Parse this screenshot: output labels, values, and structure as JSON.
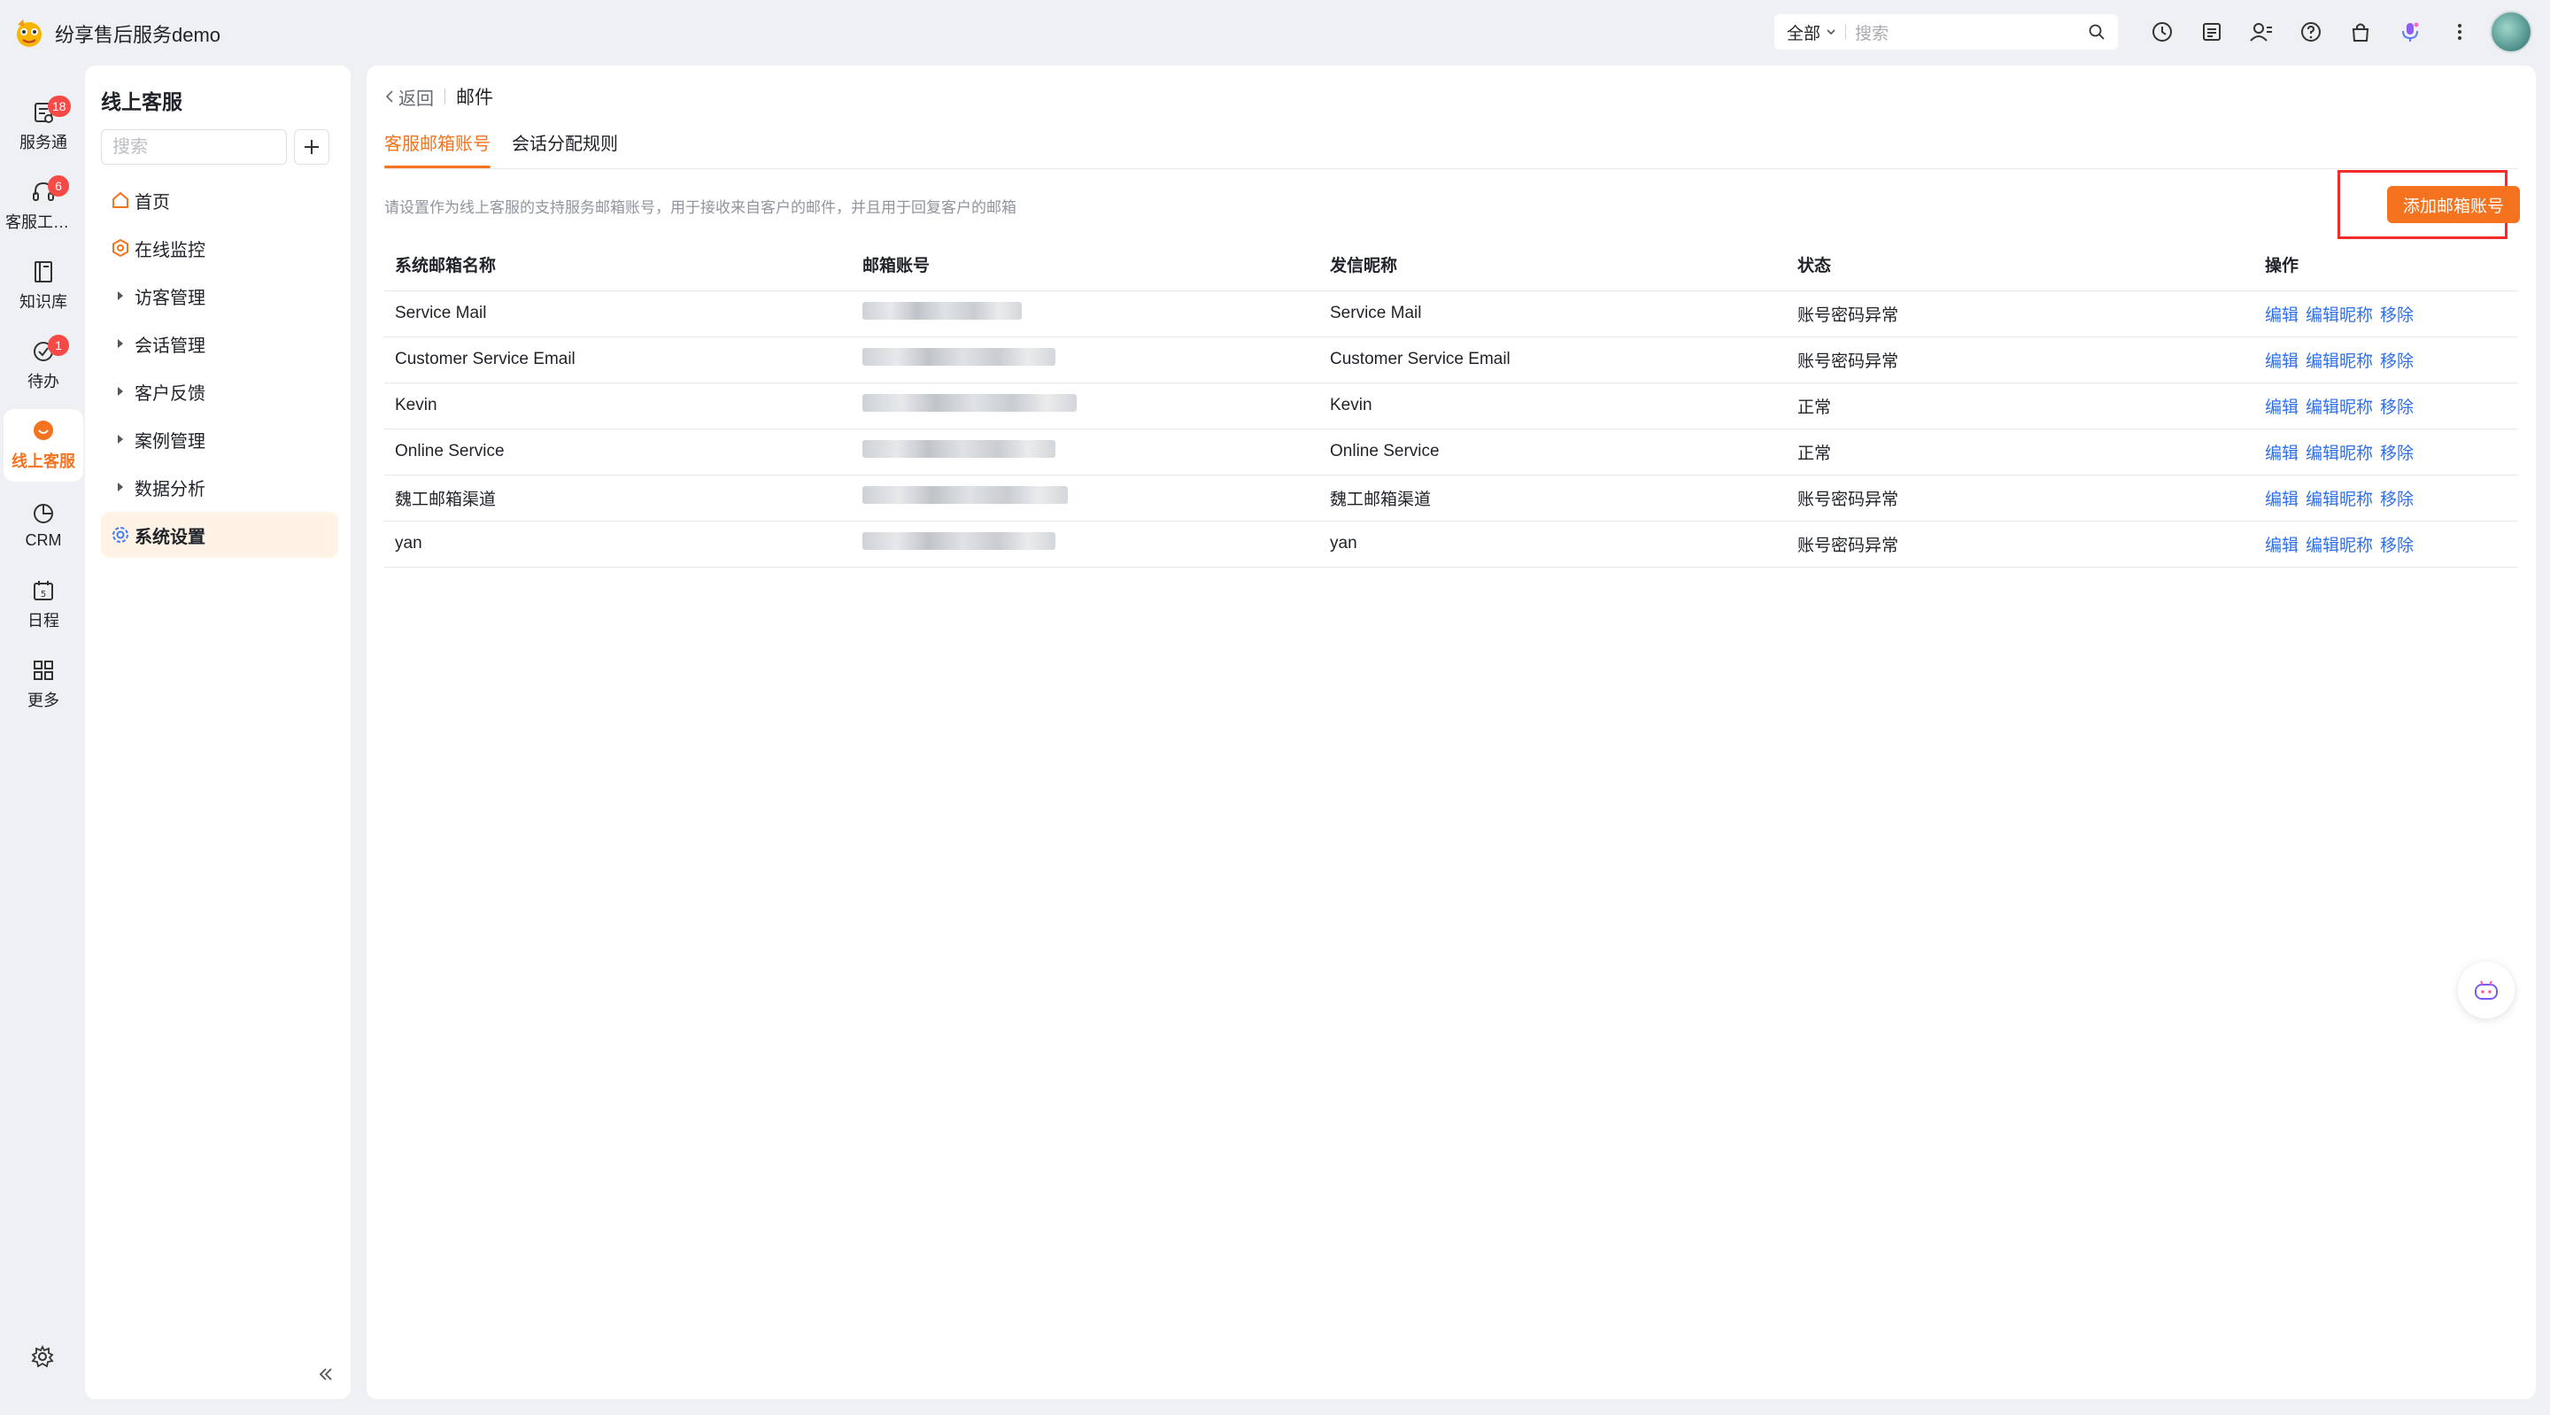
{
  "app": {
    "title": "纷享售后服务demo"
  },
  "topbar": {
    "search_scope": "全部",
    "search_placeholder": "搜索",
    "icons": [
      "clock-icon",
      "form-icon",
      "contacts-icon",
      "help-icon",
      "bag-icon",
      "ai-assistant-icon",
      "more-icon"
    ]
  },
  "rail": {
    "items": [
      {
        "label": "服务通",
        "badge": "18",
        "icon": "service-icon"
      },
      {
        "label": "客服工作台",
        "badge": "6",
        "icon": "headset-icon"
      },
      {
        "label": "知识库",
        "badge": "",
        "icon": "book-icon"
      },
      {
        "label": "待办",
        "badge": "1",
        "icon": "todo-icon"
      },
      {
        "label": "线上客服",
        "badge": "",
        "icon": "chat-icon"
      },
      {
        "label": "CRM",
        "badge": "",
        "icon": "crm-icon"
      },
      {
        "label": "日程",
        "badge": "",
        "icon": "calendar-icon"
      },
      {
        "label": "更多",
        "badge": "",
        "icon": "grid-icon"
      }
    ]
  },
  "subnav": {
    "title": "线上客服",
    "search_placeholder": "搜索",
    "items": [
      {
        "label": "首页",
        "icon": "home-icon"
      },
      {
        "label": "在线监控",
        "icon": "monitor-icon"
      },
      {
        "label": "访客管理",
        "icon": "caret-right-icon"
      },
      {
        "label": "会话管理",
        "icon": "caret-right-icon"
      },
      {
        "label": "客户反馈",
        "icon": "caret-right-icon"
      },
      {
        "label": "案例管理",
        "icon": "caret-right-icon"
      },
      {
        "label": "数据分析",
        "icon": "caret-right-icon"
      },
      {
        "label": "系统设置",
        "icon": "gear-icon"
      }
    ]
  },
  "main": {
    "back_label": "返回",
    "page_title": "邮件",
    "tabs": [
      {
        "label": "客服邮箱账号",
        "active": true
      },
      {
        "label": "会话分配规则",
        "active": false
      }
    ],
    "hint": "请设置作为线上客服的支持服务邮箱账号，用于接收来自客户的邮件，并且用于回复客户的邮箱",
    "add_button": "添加邮箱账号",
    "table": {
      "headers": [
        "系统邮箱名称",
        "邮箱账号",
        "发信昵称",
        "状态",
        "操作"
      ],
      "rows": [
        {
          "name": "Service Mail",
          "nickname": "Service Mail",
          "status": "账号密码异常"
        },
        {
          "name": "Customer Service Email",
          "nickname": "Customer Service Email",
          "status": "账号密码异常"
        },
        {
          "name": "Kevin",
          "nickname": "Kevin",
          "status": "正常"
        },
        {
          "name": "Online Service",
          "nickname": "Online Service",
          "status": "正常"
        },
        {
          "name": "魏工邮箱渠道",
          "nickname": "魏工邮箱渠道",
          "status": "账号密码异常"
        },
        {
          "name": "yan",
          "nickname": "yan",
          "status": "账号密码异常"
        }
      ],
      "actions": [
        "编辑",
        "编辑昵称",
        "移除"
      ]
    }
  },
  "colors": {
    "accent": "#f5731e",
    "link": "#2f6fe8",
    "highlight": "#f22b2b"
  }
}
